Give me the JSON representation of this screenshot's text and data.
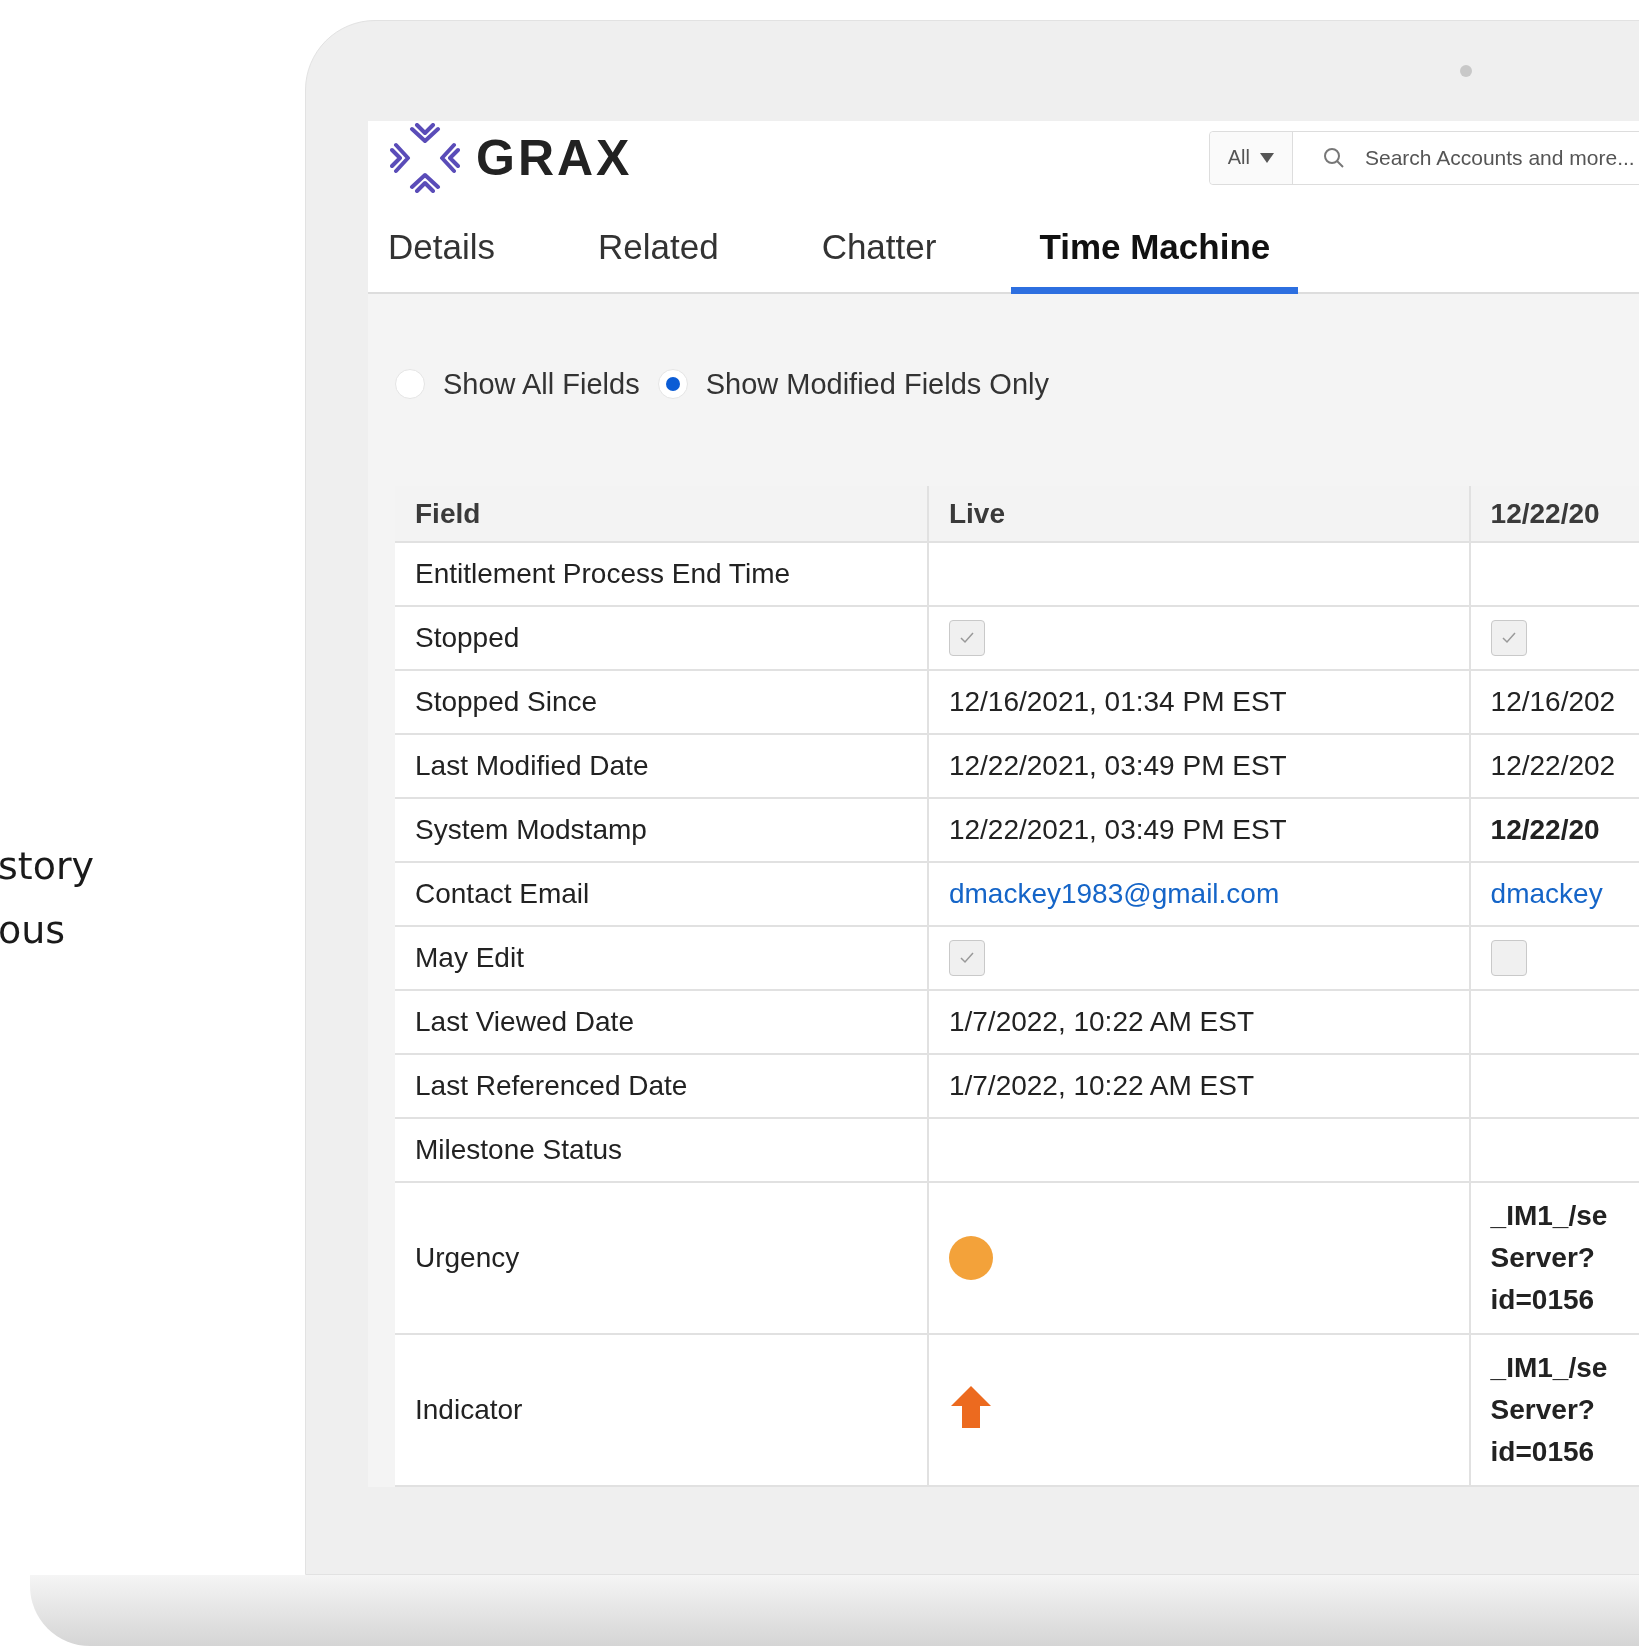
{
  "side_text": [
    "story",
    "ous"
  ],
  "logo": {
    "text": "GRAX"
  },
  "search": {
    "scope": "All",
    "placeholder": "Search Accounts and more..."
  },
  "tabs": [
    {
      "label": "Details",
      "selected": false
    },
    {
      "label": "Related",
      "selected": false
    },
    {
      "label": "Chatter",
      "selected": false
    },
    {
      "label": "Time Machine",
      "selected": true
    }
  ],
  "view_options": [
    {
      "label": "Show All Fields",
      "selected": false
    },
    {
      "label": "Show Modified Fields Only",
      "selected": true
    }
  ],
  "table": {
    "columns": [
      "Field",
      "Live",
      "12/22/20"
    ],
    "rows": [
      {
        "cells": [
          {
            "kind": "field",
            "text": "Entitlement Process End Time"
          },
          {
            "kind": "blank"
          },
          {
            "kind": "blank"
          }
        ]
      },
      {
        "cells": [
          {
            "kind": "field",
            "text": "Stopped"
          },
          {
            "kind": "checkbox",
            "checked": true
          },
          {
            "kind": "checkbox",
            "checked": true
          }
        ]
      },
      {
        "cells": [
          {
            "kind": "field",
            "text": "Stopped Since"
          },
          {
            "kind": "text",
            "text": "12/16/2021, 01:34 PM EST"
          },
          {
            "kind": "text",
            "text": "12/16/202"
          }
        ]
      },
      {
        "cells": [
          {
            "kind": "field",
            "text": "Last Modified Date"
          },
          {
            "kind": "text",
            "text": "12/22/2021, 03:49 PM EST"
          },
          {
            "kind": "text",
            "text": "12/22/202"
          }
        ]
      },
      {
        "cells": [
          {
            "kind": "field",
            "text": "System Modstamp"
          },
          {
            "kind": "text",
            "text": "12/22/2021, 03:49 PM EST"
          },
          {
            "kind": "bold",
            "text": "12/22/20"
          }
        ]
      },
      {
        "cells": [
          {
            "kind": "field",
            "text": "Contact Email"
          },
          {
            "kind": "link",
            "text": "dmackey1983@gmail.com"
          },
          {
            "kind": "link",
            "text": "dmackey"
          }
        ]
      },
      {
        "cells": [
          {
            "kind": "field",
            "text": "May Edit"
          },
          {
            "kind": "checkbox",
            "checked": true
          },
          {
            "kind": "checkbox",
            "checked": false
          }
        ]
      },
      {
        "cells": [
          {
            "kind": "field",
            "text": "Last Viewed Date"
          },
          {
            "kind": "text",
            "text": "1/7/2022, 10:22 AM EST"
          },
          {
            "kind": "blank"
          }
        ]
      },
      {
        "cells": [
          {
            "kind": "field",
            "text": "Last Referenced Date"
          },
          {
            "kind": "text",
            "text": "1/7/2022, 10:22 AM EST"
          },
          {
            "kind": "blank"
          }
        ]
      },
      {
        "cells": [
          {
            "kind": "field",
            "text": "Milestone Status"
          },
          {
            "kind": "blank"
          },
          {
            "kind": "blank"
          }
        ]
      },
      {
        "cells": [
          {
            "kind": "field",
            "text": "Urgency"
          },
          {
            "kind": "dot"
          },
          {
            "kind": "lines",
            "lines": [
              "_IM1_/se",
              "Server?",
              "id=0156"
            ]
          }
        ]
      },
      {
        "cells": [
          {
            "kind": "field",
            "text": "Indicator"
          },
          {
            "kind": "arrow"
          },
          {
            "kind": "lines",
            "lines": [
              "_IM1_/se",
              "Server?",
              "id=0156"
            ]
          }
        ]
      }
    ]
  }
}
